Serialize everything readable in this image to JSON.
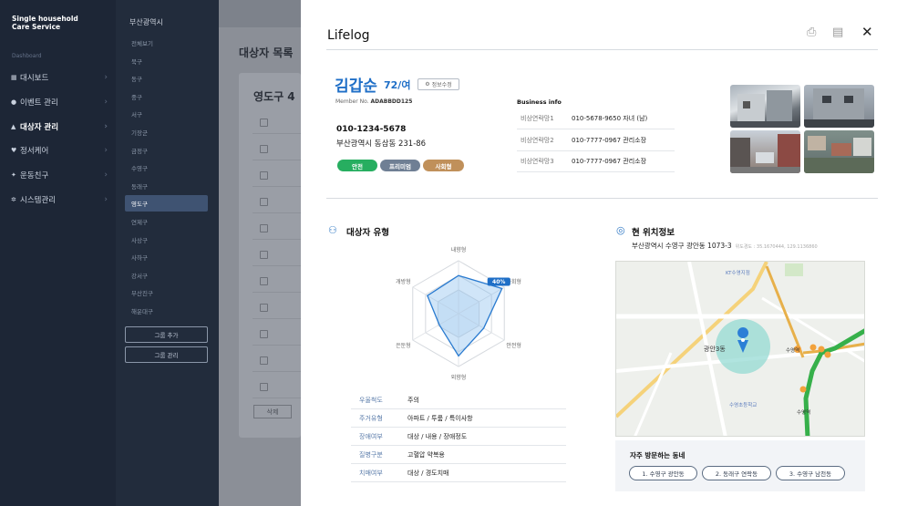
{
  "app": {
    "brand": "Single household\nCare Service",
    "nav_label": "Dashboard"
  },
  "nav": [
    {
      "icon": "grid-icon",
      "glyph": "▦",
      "label": "대시보드"
    },
    {
      "icon": "bell-icon",
      "glyph": "●",
      "label": "이벤트 관리"
    },
    {
      "icon": "user-icon",
      "glyph": "▲",
      "label": "대상자 관리"
    },
    {
      "icon": "heart-icon",
      "glyph": "♥",
      "label": "정서케어"
    },
    {
      "icon": "run-icon",
      "glyph": "✦",
      "label": "운동친구"
    },
    {
      "icon": "gear-icon",
      "glyph": "✲",
      "label": "시스템관리"
    }
  ],
  "subnav": {
    "title": "부산광역시",
    "items": [
      "전체보기",
      "북구",
      "동구",
      "중구",
      "서구",
      "기장군",
      "금정구",
      "수영구",
      "동래구",
      "영도구",
      "연제구",
      "사상구",
      "사하구",
      "강서구",
      "부산진구",
      "해운대구"
    ],
    "active": "영도구",
    "add_group": "그룹 추가",
    "manage_group": "그룹 관리"
  },
  "background_page": {
    "title": "대상자 목록",
    "card_title": "영도구 4",
    "delete_btn": "삭제"
  },
  "panel": {
    "title": "Lifelog",
    "profile": {
      "name": "김갑순",
      "age_gender": "72/여",
      "edit_label": "정보수정",
      "member_label": "Member No.",
      "member_no": "ADABBDD125",
      "phone": "010-1234-5678",
      "address": "부산광역시 동삼동 231-86",
      "tags": [
        {
          "label": "안전",
          "color": "#27ae60"
        },
        {
          "label": "프리미엄",
          "color": "#6f7f94"
        },
        {
          "label": "사회형",
          "color": "#c0905a"
        }
      ]
    },
    "business": {
      "label": "Business info",
      "rows": [
        {
          "key": "비상연락망1",
          "value": "010-5678-9650 자녀 (남)"
        },
        {
          "key": "비상연락망2",
          "value": "010-7777-0967 관리소장"
        },
        {
          "key": "비상연락망3",
          "value": "010-7777-0967 관리소장"
        }
      ]
    },
    "type_section": {
      "title": "대상자 유형",
      "radar_labels": [
        "내향형",
        "사회형",
        "안전형",
        "외향형",
        "은둔형",
        "개방형"
      ],
      "radar_values": [
        0.72,
        0.95,
        0.55,
        0.8,
        0.42,
        0.68
      ],
      "highlight_label": "40%",
      "rows": [
        {
          "key": "우울척도",
          "value": "주의"
        },
        {
          "key": "주거유형",
          "value": "아파트 / 투룸 / 특이사항"
        },
        {
          "key": "장애여부",
          "value": "대상 / 내용 / 장애정도"
        },
        {
          "key": "질병구분",
          "value": "고혈압 약복용"
        },
        {
          "key": "치매여부",
          "value": "대상 / 경도치매"
        }
      ]
    },
    "location": {
      "title": "현 위치정보",
      "address": "부산광역시 수영구 광안동 1073-3",
      "coords": "위도경도 : 35.1670444, 129.1136860",
      "map_labels": {
        "area": "광안3동",
        "station": "수영역",
        "station2": "수영역",
        "school": "수영초등학교",
        "kt": "KT수영지점"
      }
    },
    "frequent": {
      "title": "자주 방문하는 동네",
      "items": [
        "1. 수영구 광안동",
        "2. 동래구 연락동",
        "3. 수영구 남천동"
      ]
    }
  }
}
